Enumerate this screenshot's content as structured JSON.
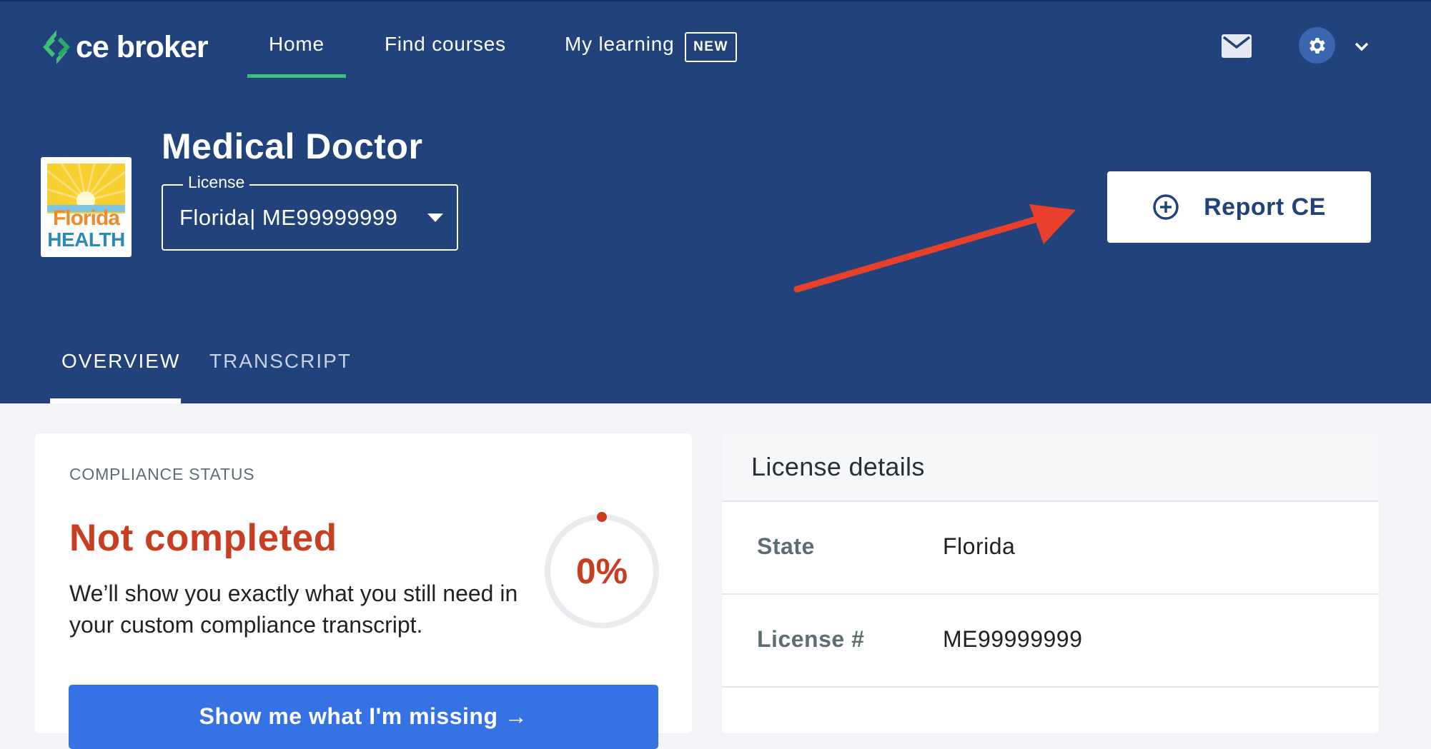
{
  "app": {
    "brand": "ce broker"
  },
  "nav": {
    "items": [
      {
        "label": "Home",
        "active": true
      },
      {
        "label": "Find courses",
        "active": false
      },
      {
        "label": "My learning",
        "active": false
      }
    ],
    "new_badge": "NEW"
  },
  "icons": {
    "logo": "ce-broker-logo-icon",
    "mail": "mail-icon",
    "settings": "gear-icon",
    "menu": "chevron-down-icon",
    "report": "plus-circle-icon",
    "annotation": "red-arrow-annotation"
  },
  "header": {
    "title": "Medical Doctor",
    "license_logo_text": {
      "line1": "Florida",
      "line2": "HEALTH"
    },
    "license_field": {
      "legend": "License",
      "value": "Florida| ME99999999"
    },
    "report_button": "Report CE"
  },
  "tabs": [
    {
      "label": "OVERVIEW",
      "active": true
    },
    {
      "label": "TRANSCRIPT",
      "active": false
    }
  ],
  "compliance": {
    "label": "COMPLIANCE STATUS",
    "status": "Not completed",
    "description": "We’ll show you exactly what you still need in your custom compliance transcript.",
    "percent_text": "0%",
    "progress": 0,
    "button": "Show me what I'm missing →"
  },
  "license_details": {
    "title": "License details",
    "rows": [
      {
        "key": "State",
        "value": "Florida"
      },
      {
        "key": "License #",
        "value": "ME99999999"
      }
    ]
  },
  "colors": {
    "header_bg": "#21427a",
    "accent_green": "#3fbf7a",
    "status_red": "#c93d21",
    "primary_button": "#3572e3",
    "annotation_red": "#e8402a"
  }
}
